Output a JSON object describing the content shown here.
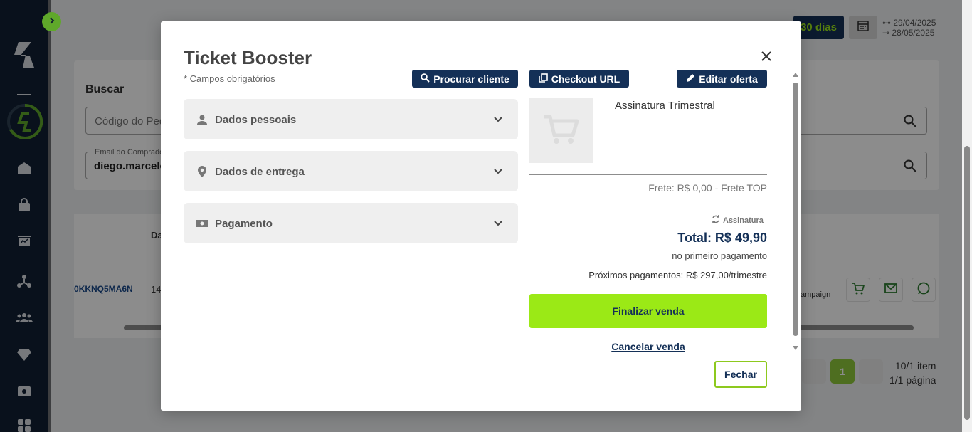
{
  "sidebar": {
    "icons": [
      "chevron-right-icon",
      "brand-logo",
      "avatar",
      "home-icon",
      "bag-icon",
      "presentation-icon",
      "network-icon",
      "people-icon",
      "diamond-icon",
      "ticket-icon",
      "apps-icon"
    ]
  },
  "background": {
    "filter_period": "30 dias",
    "date_from": "29/04/2025",
    "date_to": "28/05/2025",
    "search_title": "Buscar",
    "order_code_placeholder": "Código do Ped",
    "buyer_email_label": "Email do Comprado",
    "buyer_email_value": "diego.marcelo",
    "table_header_partial": "Da",
    "order_code": "0KKNQ5MA6N",
    "order_date_partial": "14",
    "campaign_partial": "ampaign",
    "pagination": {
      "current_page": "1",
      "items": "10/1 item",
      "pages": "1/1 página"
    }
  },
  "modal": {
    "title": "Ticket Booster",
    "required_note": "* Campos obrigatórios",
    "buttons": {
      "find_customer": "Procurar cliente",
      "checkout_url": "Checkout URL",
      "edit_offer": "Editar oferta"
    },
    "sections": [
      {
        "label": "Dados pessoais",
        "icon": "person-icon"
      },
      {
        "label": "Dados de entrega",
        "icon": "location-pin-icon"
      },
      {
        "label": "Pagamento",
        "icon": "cash-icon"
      }
    ],
    "product": {
      "name": "Assinatura Trimestral",
      "shipping": "Frete: R$ 0,00 - Frete TOP",
      "subscription_tag": "Assinatura",
      "total": "Total: R$ 49,90",
      "first_payment_note": "no primeiro pagamento",
      "next_payments": "Próximos pagamentos: R$ 297,00/trimestre"
    },
    "actions": {
      "finalize": "Finalizar venda",
      "cancel": "Cancelar venda",
      "close": "Fechar"
    }
  },
  "colors": {
    "brand_navy": "#143057",
    "brand_green": "#9be916",
    "sidebar_bg": "#112033",
    "accent_green": "#5fa82a"
  }
}
